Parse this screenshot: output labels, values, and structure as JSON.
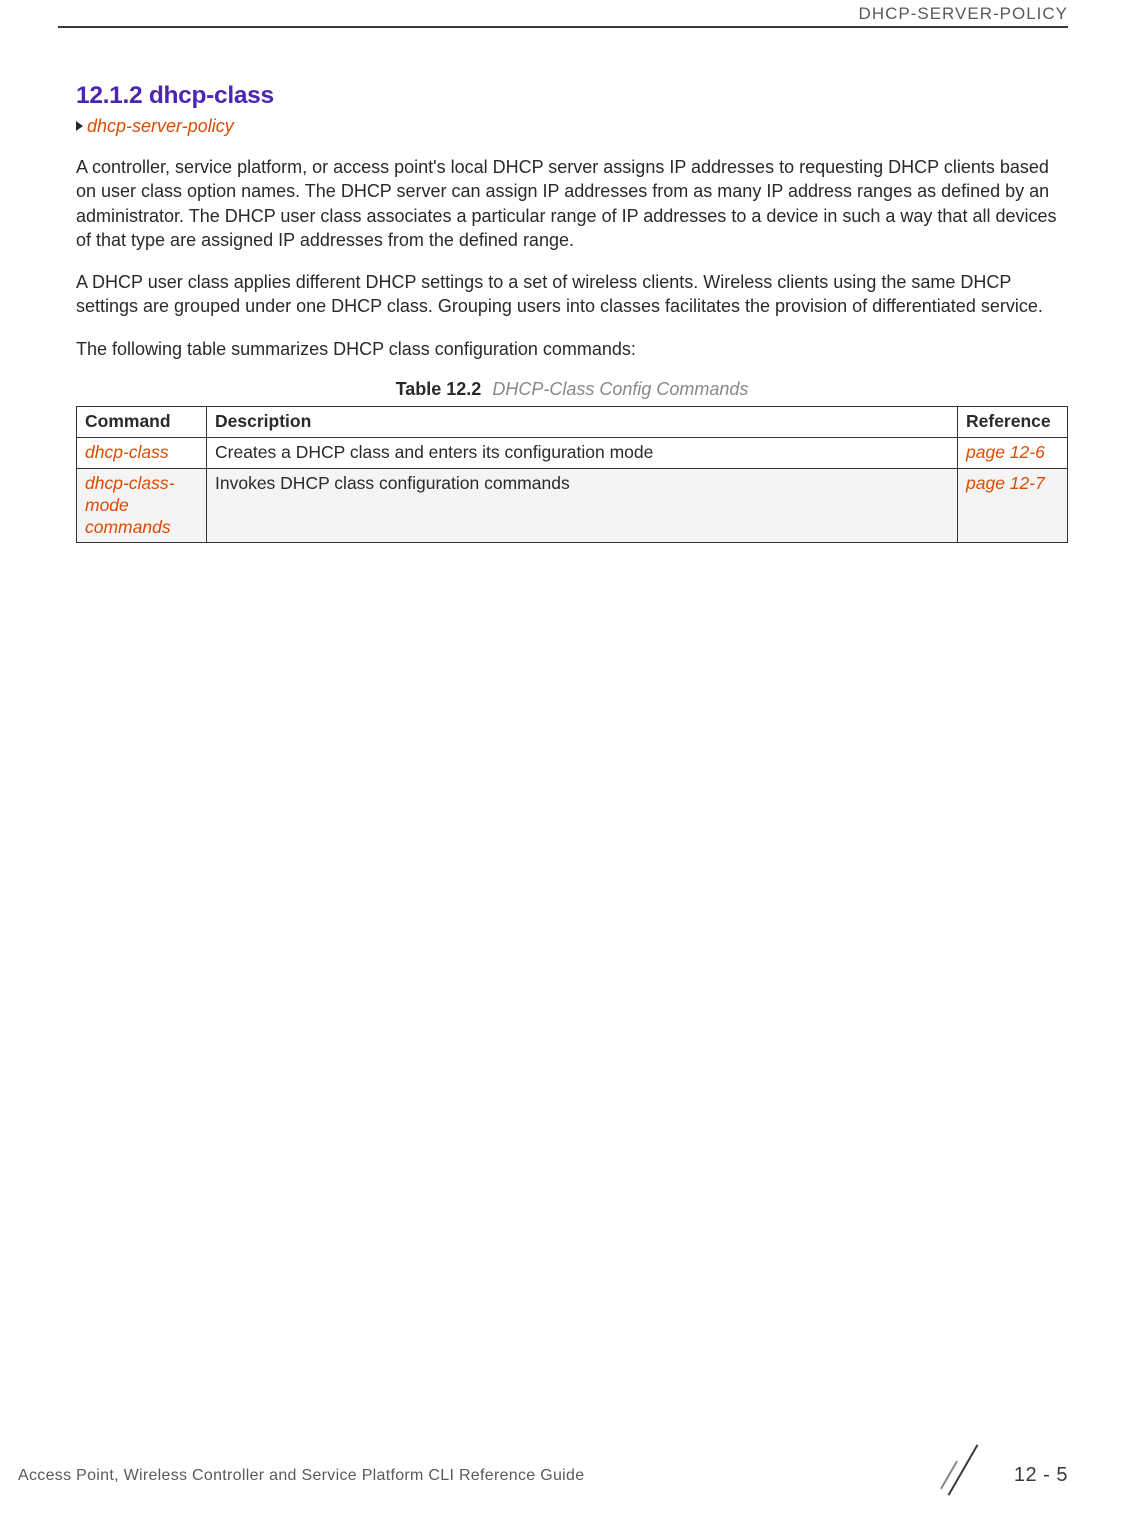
{
  "header": {
    "running_title": "DHCP-SERVER-POLICY"
  },
  "section": {
    "number": "12.1.2",
    "title": "dhcp-class",
    "breadcrumb": "dhcp-server-policy",
    "para1": "A controller, service platform, or access point's local DHCP server assigns IP addresses to requesting DHCP clients based on user class option names. The DHCP server can assign IP addresses from as many IP address ranges as defined by an administrator. The DHCP user class associates a particular range of IP addresses to a device in such a way that all devices of that type are assigned IP addresses from the defined range.",
    "para2": "A DHCP user class applies different DHCP settings to a set of wireless clients. Wireless clients using the same DHCP settings are grouped under one DHCP class. Grouping users into classes facilitates the provision of differentiated service.",
    "para3": "The following table summarizes DHCP class configuration commands:"
  },
  "table": {
    "caption_label": "Table 12.2",
    "caption_text": "DHCP-Class Config Commands",
    "headers": {
      "command": "Command",
      "description": "Description",
      "reference": "Reference"
    },
    "rows": [
      {
        "command": "dhcp-class",
        "description": "Creates a DHCP class and enters its configuration mode",
        "reference": "page 12-6"
      },
      {
        "command": "dhcp-class-mode commands",
        "description": "Invokes DHCP class configuration commands",
        "reference": "page 12-7"
      }
    ]
  },
  "footer": {
    "guide": "Access Point, Wireless Controller and Service Platform CLI Reference Guide",
    "page_label": "12 - 5"
  }
}
